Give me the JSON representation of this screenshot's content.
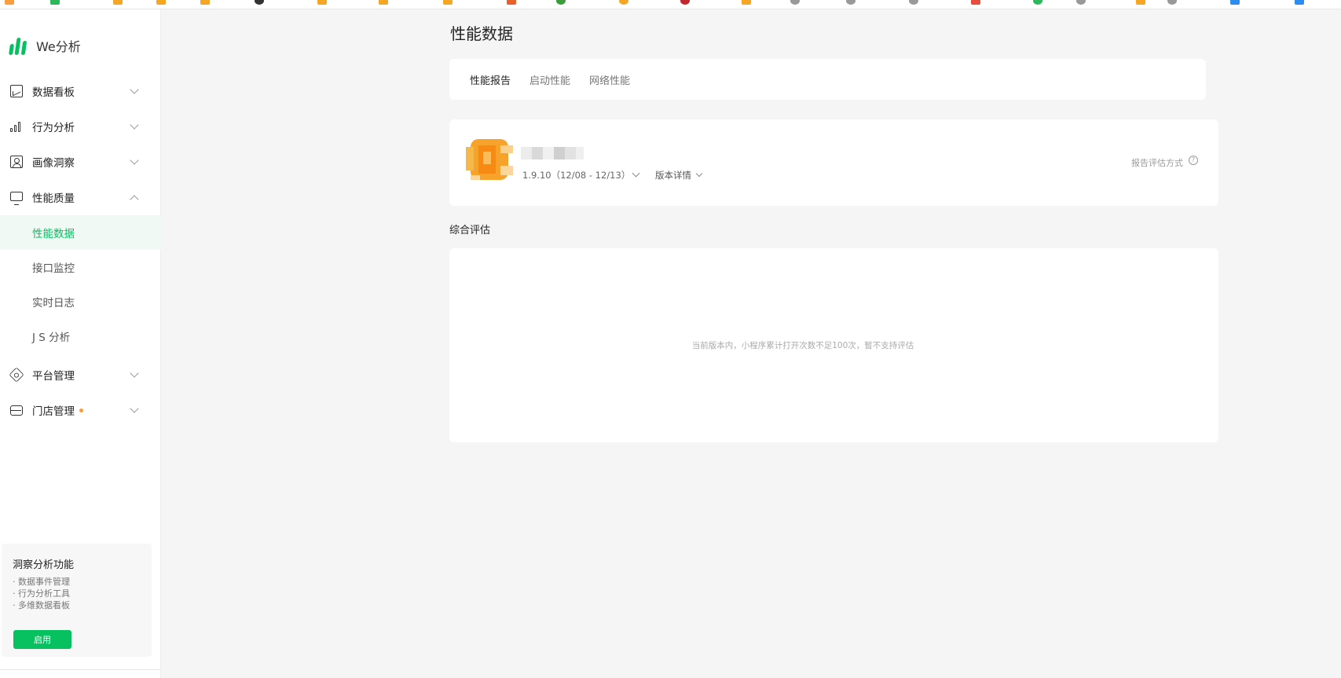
{
  "brand": {
    "name": "We分析"
  },
  "sidebar": {
    "menu": [
      {
        "label": "数据看板",
        "icon": "dashboard-icon",
        "expanded": false
      },
      {
        "label": "行为分析",
        "icon": "bar-chart-icon",
        "expanded": false
      },
      {
        "label": "画像洞察",
        "icon": "portrait-icon",
        "expanded": false
      },
      {
        "label": "性能质量",
        "icon": "monitor-icon",
        "expanded": true
      },
      {
        "label": "平台管理",
        "icon": "settings-icon",
        "expanded": false
      },
      {
        "label": "门店管理",
        "icon": "store-icon",
        "expanded": false,
        "badge_dot": true
      }
    ],
    "submenu": [
      {
        "label": "性能数据",
        "active": true
      },
      {
        "label": "接口监控",
        "active": false
      },
      {
        "label": "实时日志",
        "active": false
      },
      {
        "label": "J S 分析",
        "active": false
      }
    ]
  },
  "promo": {
    "title": "洞察分析功能",
    "features": [
      "· 数据事件管理",
      "· 行为分析工具",
      "· 多维数据看板"
    ],
    "button_label": "启用"
  },
  "main": {
    "title": "性能数据",
    "tabs": [
      {
        "label": "性能报告",
        "active": true
      },
      {
        "label": "启动性能",
        "active": false
      },
      {
        "label": "网络性能",
        "active": false
      }
    ],
    "app_info": {
      "version": "1.9.10（12/08 - 12/13）",
      "version_detail_label": "版本详情",
      "eval_method_label": "报告评估方式"
    },
    "evaluation": {
      "section_title": "综合评估",
      "empty_message": "当前版本内，小程序累计打开次数不足100次，暂不支持评估"
    }
  },
  "colors": {
    "accent": "#07c160",
    "active_bg": "#f0f9f4",
    "page_bg": "#f5f5f5",
    "badge_dot": "#fa9d3b"
  }
}
